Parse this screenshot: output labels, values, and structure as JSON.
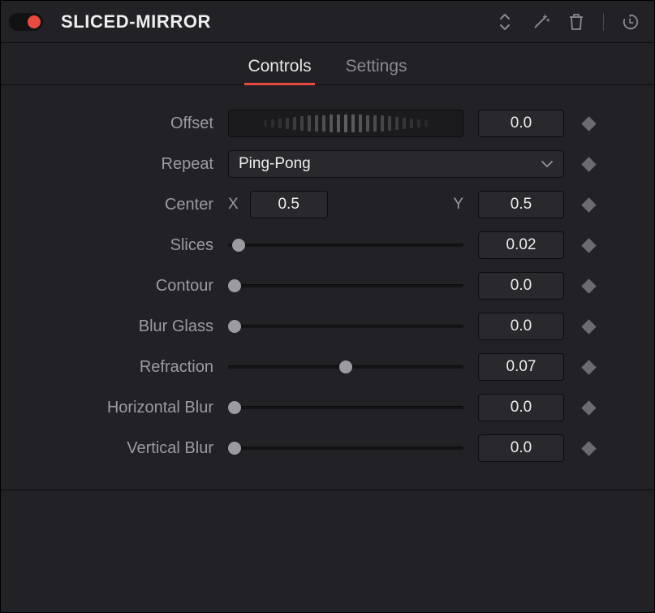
{
  "header": {
    "title": "SLICED-MIRROR"
  },
  "tabs": {
    "controls": "Controls",
    "settings": "Settings"
  },
  "params": {
    "offset": {
      "label": "Offset",
      "value": "0.0"
    },
    "repeat": {
      "label": "Repeat",
      "value": "Ping-Pong"
    },
    "center": {
      "label": "Center",
      "x_label": "X",
      "x": "0.5",
      "y_label": "Y",
      "y": "0.5"
    },
    "slices": {
      "label": "Slices",
      "value": "0.02",
      "pos": 0.02
    },
    "contour": {
      "label": "Contour",
      "value": "0.0",
      "pos": 0.0
    },
    "blur_glass": {
      "label": "Blur Glass",
      "value": "0.0",
      "pos": 0.0
    },
    "refraction": {
      "label": "Refraction",
      "value": "0.07",
      "pos": 0.5
    },
    "horizontal_blur": {
      "label": "Horizontal Blur",
      "value": "0.0",
      "pos": 0.0
    },
    "vertical_blur": {
      "label": "Vertical Blur",
      "value": "0.0",
      "pos": 0.0
    }
  }
}
